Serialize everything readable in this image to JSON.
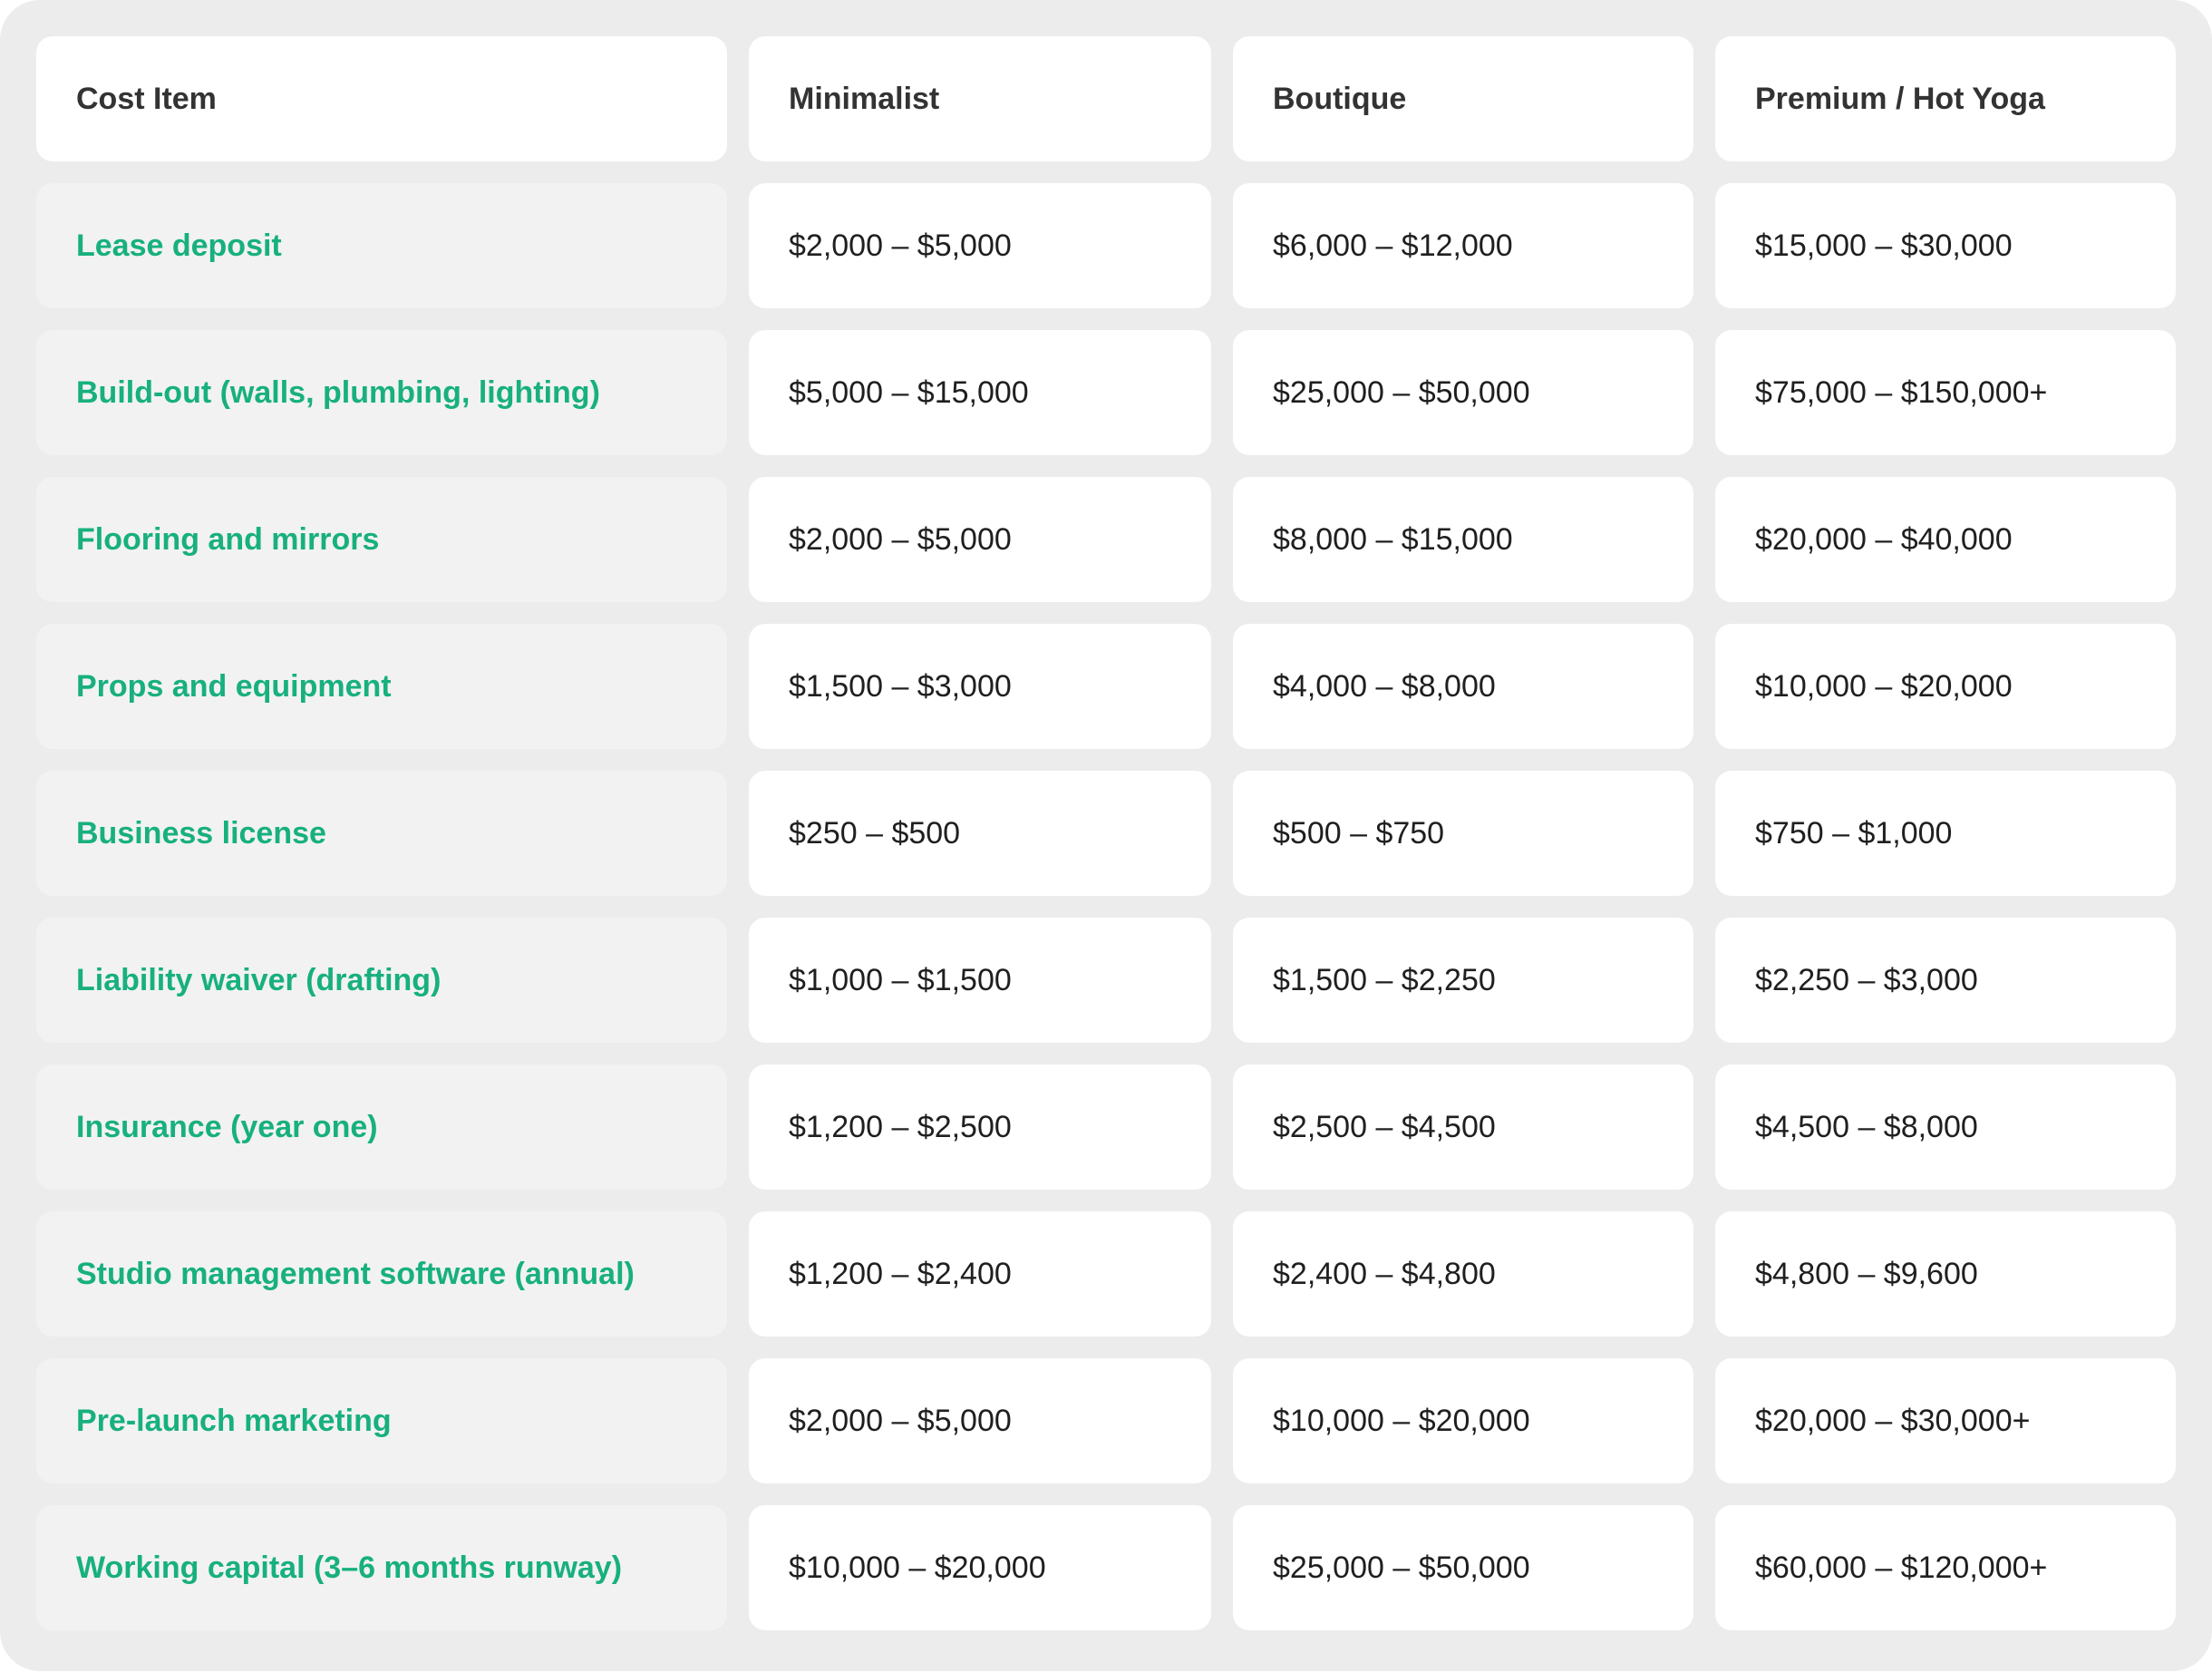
{
  "table": {
    "headers": [
      "Cost Item",
      "Minimalist",
      "Boutique",
      "Premium / Hot Yoga"
    ],
    "rows": [
      [
        "Lease deposit",
        "$2,000 – $5,000",
        "$6,000 – $12,000",
        "$15,000 – $30,000"
      ],
      [
        "Build-out (walls, plumbing, lighting)",
        "$5,000 – $15,000",
        "$25,000 – $50,000",
        "$75,000 – $150,000+"
      ],
      [
        "Flooring and mirrors",
        "$2,000 – $5,000",
        "$8,000 – $15,000",
        "$20,000 – $40,000"
      ],
      [
        "Props and equipment",
        "$1,500 – $3,000",
        "$4,000 – $8,000",
        "$10,000 – $20,000"
      ],
      [
        "Business license",
        "$250 – $500",
        "$500 – $750",
        "$750 – $1,000"
      ],
      [
        "Liability waiver (drafting)",
        "$1,000 – $1,500",
        "$1,500 – $2,250",
        "$2,250 – $3,000"
      ],
      [
        "Insurance (year one)",
        "$1,200 – $2,500",
        "$2,500 – $4,500",
        "$4,500 – $8,000"
      ],
      [
        "Studio management software (annual)",
        "$1,200 – $2,400",
        "$2,400 – $4,800",
        "$4,800 – $9,600"
      ],
      [
        "Pre-launch marketing",
        "$2,000 – $5,000",
        "$10,000 – $20,000",
        "$20,000 – $30,000+"
      ],
      [
        "Working capital (3–6 months runway)",
        "$10,000 – $20,000",
        "$25,000 – $50,000",
        "$60,000 – $120,000+"
      ]
    ]
  },
  "colors": {
    "panel_background": "#ececec",
    "item_text": "#17b07e",
    "item_cell_background": "#f2f2f2",
    "value_cell_background": "#ffffff",
    "header_text": "#333333"
  }
}
